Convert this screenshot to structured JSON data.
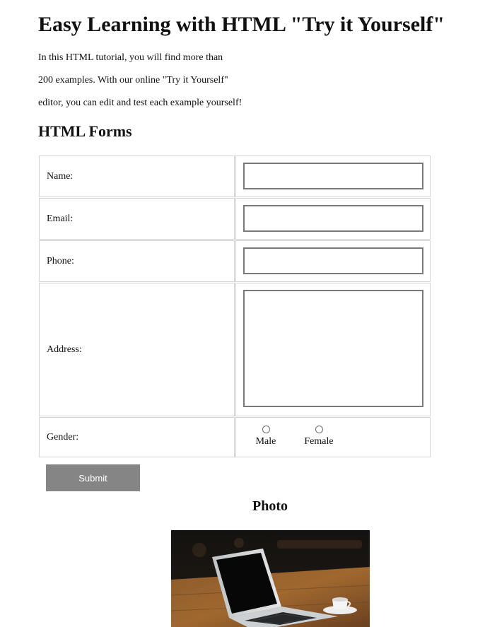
{
  "header": {
    "title": "Easy Learning with HTML \"Try it Yourself\"",
    "intro_lines": [
      "In this HTML tutorial, you will find more than",
      "200 examples. With our online \"Try it Yourself\"",
      "editor, you can edit and test each example yourself!"
    ]
  },
  "form": {
    "heading": "HTML Forms",
    "fields": {
      "name": {
        "label": "Name:",
        "value": ""
      },
      "email": {
        "label": "Email:",
        "value": ""
      },
      "phone": {
        "label": "Phone:",
        "value": ""
      },
      "address": {
        "label": "Address:",
        "value": ""
      }
    },
    "gender": {
      "label": "Gender:",
      "options": [
        "Male",
        "Female"
      ],
      "selected": null
    },
    "submit_label": "Submit"
  },
  "photo": {
    "heading": "Photo",
    "icon": "laptop-coffee-photo"
  },
  "colors": {
    "submit_background": "#858585",
    "submit_text": "#ffffff",
    "table_border": "#d3d3d3",
    "input_border": "#7a7a7a"
  }
}
